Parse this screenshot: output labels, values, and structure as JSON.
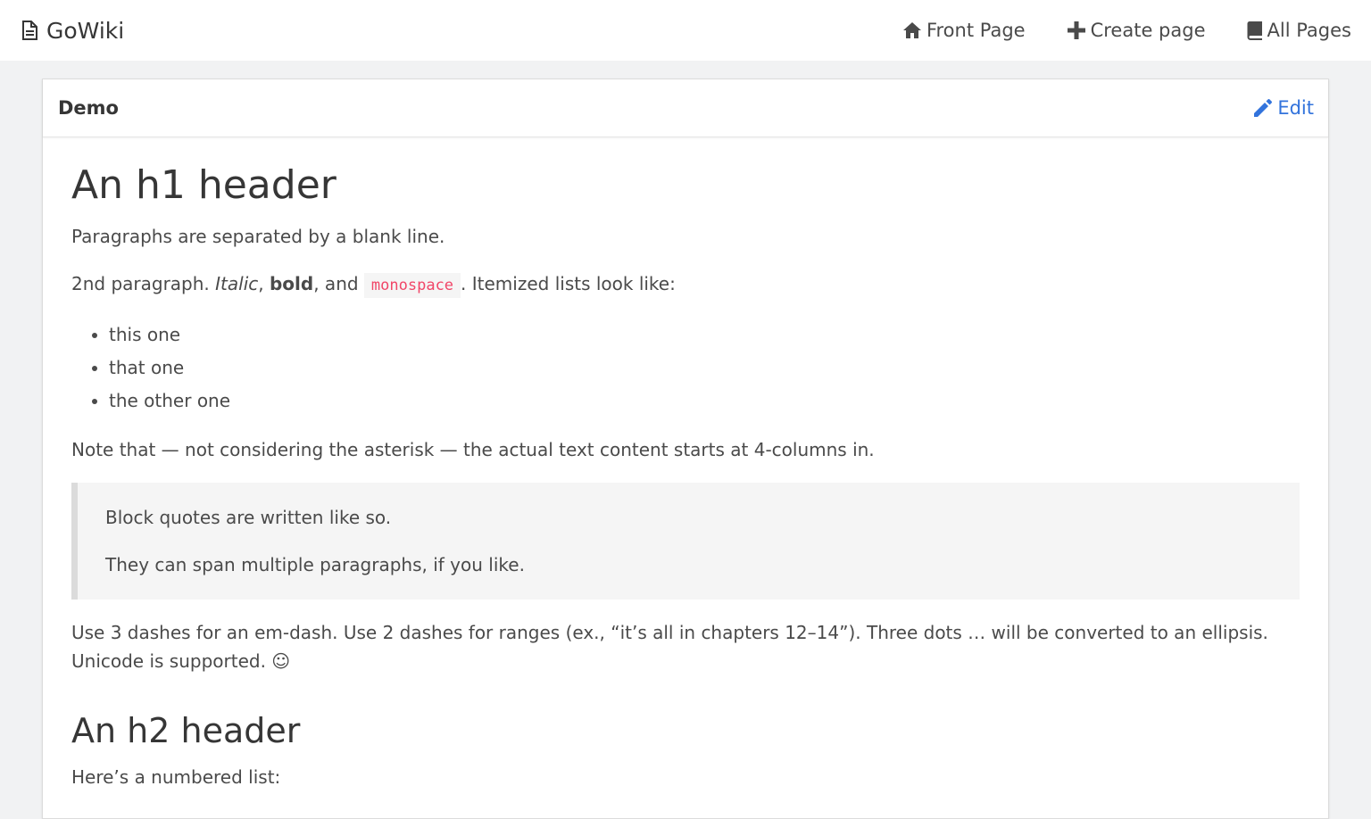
{
  "navbar": {
    "brand": "GoWiki",
    "links": [
      {
        "label": "Front Page",
        "icon": "home-icon"
      },
      {
        "label": "Create page",
        "icon": "plus-icon"
      },
      {
        "label": "All Pages",
        "icon": "book-icon"
      }
    ]
  },
  "card": {
    "title": "Demo",
    "edit_label": "Edit"
  },
  "content": {
    "h1": "An h1 header",
    "p1": "Paragraphs are separated by a blank line.",
    "p2": {
      "before": "2nd paragraph. ",
      "italic": "Italic",
      "comma": ", ",
      "bold": "bold",
      "and": ", and ",
      "code": "monospace",
      "after": ". Itemized lists look like:"
    },
    "list": [
      "this one",
      "that one",
      "the other one"
    ],
    "note": "Note that — not considering the asterisk — the actual text content starts at 4-columns in.",
    "blockquote": [
      "Block quotes are written like so.",
      "They can span multiple paragraphs, if you like."
    ],
    "dashes": "Use 3 dashes for an em-dash. Use 2 dashes for ranges (ex., “it’s all in chapters 12–14”). Three dots … will be converted to an ellipsis. Unicode is supported. ☺",
    "h2": "An h2 header",
    "numbered_intro": "Here’s a numbered list:"
  },
  "colors": {
    "link": "#3273dc",
    "code": "#f14668",
    "background": "#f1f2f3"
  }
}
